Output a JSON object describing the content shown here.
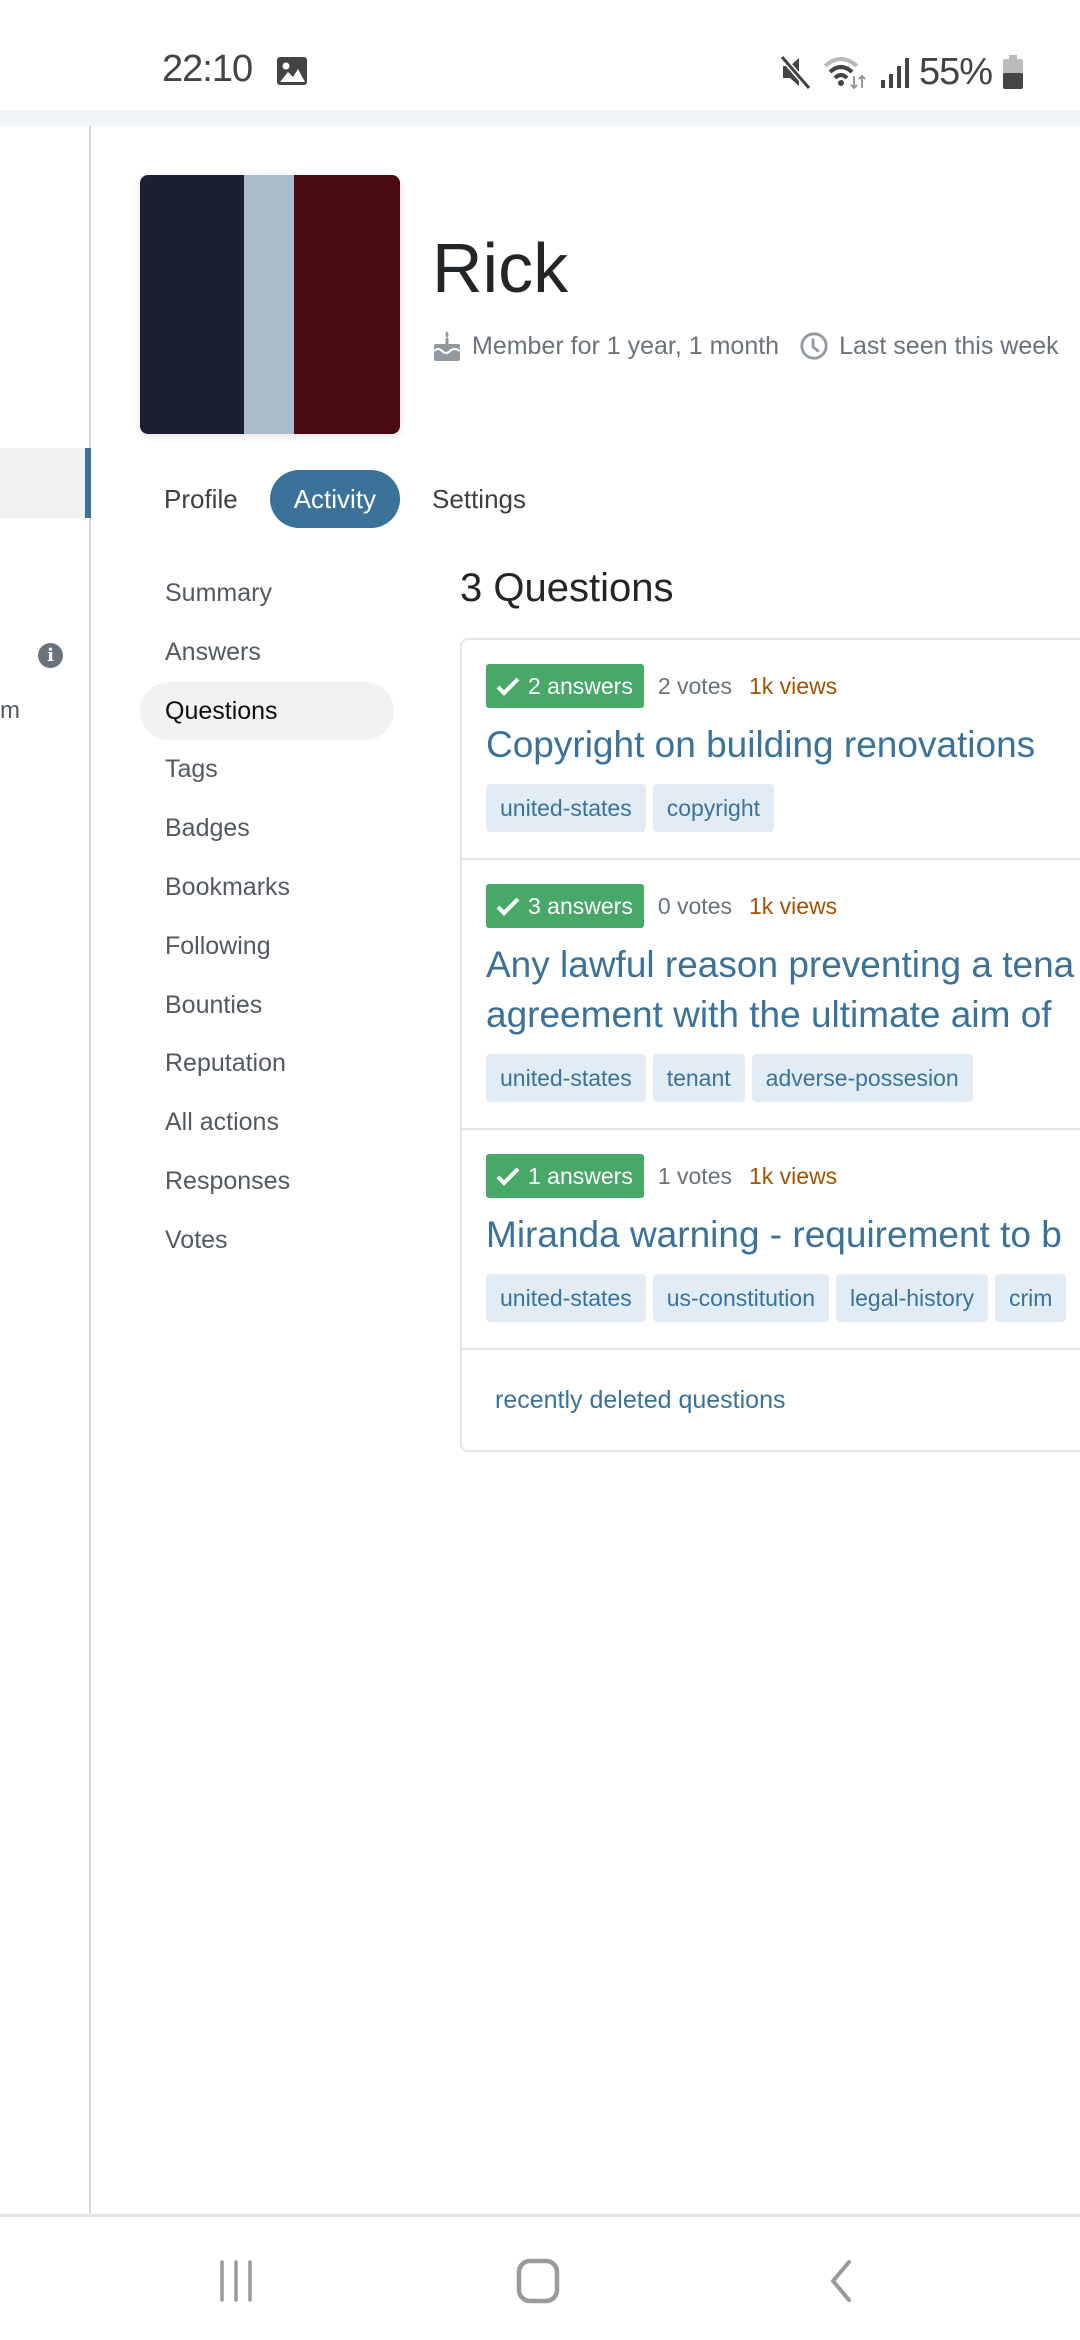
{
  "status_bar": {
    "time": "22:10",
    "battery_percent": "55%",
    "icons": [
      "gallery-icon",
      "mute-icon",
      "wifi-icon",
      "signal-icon",
      "battery-icon"
    ]
  },
  "left_sidebar": {
    "snippet_text": "m",
    "info_icon": "info-icon"
  },
  "profile": {
    "name": "Rick",
    "member_for": "Member for 1 year, 1 month",
    "last_seen": "Last seen this week",
    "avatar_colors": [
      "#1a1f33",
      "#aabbcc",
      "#4a0c12"
    ]
  },
  "tabs": [
    {
      "label": "Profile",
      "active": false
    },
    {
      "label": "Activity",
      "active": true
    },
    {
      "label": "Settings",
      "active": false
    }
  ],
  "subnav": [
    {
      "label": "Summary",
      "active": false
    },
    {
      "label": "Answers",
      "active": false
    },
    {
      "label": "Questions",
      "active": true
    },
    {
      "label": "Tags",
      "active": false
    },
    {
      "label": "Badges",
      "active": false
    },
    {
      "label": "Bookmarks",
      "active": false
    },
    {
      "label": "Following",
      "active": false
    },
    {
      "label": "Bounties",
      "active": false
    },
    {
      "label": "Reputation",
      "active": false
    },
    {
      "label": "All actions",
      "active": false
    },
    {
      "label": "Responses",
      "active": false
    },
    {
      "label": "Votes",
      "active": false
    }
  ],
  "main": {
    "title": "3 Questions",
    "questions": [
      {
        "answers": "2 answers",
        "votes": "2 votes",
        "views": "1k views",
        "title": "Copyright on building renovations",
        "tags": [
          "united-states",
          "copyright"
        ]
      },
      {
        "answers": "3 answers",
        "votes": "0 votes",
        "views": "1k views",
        "title_lines": [
          "Any lawful reason preventing a tena",
          "agreement with the ultimate aim of"
        ],
        "tags": [
          "united-states",
          "tenant",
          "adverse-possesion"
        ]
      },
      {
        "answers": "1 answers",
        "votes": "1 votes",
        "views": "1k views",
        "title": "Miranda warning - requirement to b",
        "tags": [
          "united-states",
          "us-constitution",
          "legal-history",
          "crim"
        ]
      }
    ],
    "footer_link": "recently deleted questions"
  },
  "colors": {
    "accent": "#3b7299",
    "accepted_green": "#48a868",
    "views_orange": "#a35200",
    "tag_bg": "#e1ecf4",
    "tag_text": "#39739d"
  },
  "nav_bar": {
    "buttons": [
      "recent-apps",
      "home",
      "back"
    ]
  }
}
